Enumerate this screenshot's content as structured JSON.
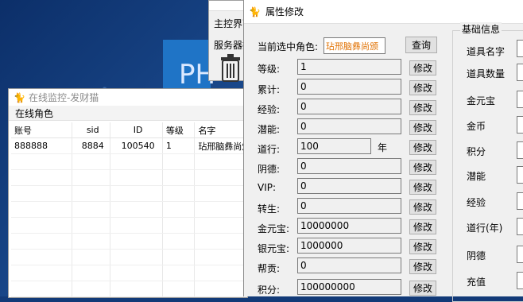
{
  "main_window": {
    "row1": "主控界面",
    "row2": "服务器控"
  },
  "blue_tile": "PH",
  "monitor": {
    "title": "在线监控-发财猫",
    "menu": "在线角色",
    "columns": [
      "账号",
      "sid",
      "ID",
      "等级",
      "名字"
    ],
    "rows": [
      [
        "888888",
        "8884",
        "100540",
        "1",
        "玷邢脑彝尚颁"
      ]
    ]
  },
  "props": {
    "title": "属性修改",
    "selected_label": "当前选中角色:",
    "selected_value": "玷邢脑彝尚颁",
    "query_button": "查询",
    "modify_label": "修改",
    "year_unit": "年",
    "fields": [
      {
        "label": "等级:",
        "value": "1"
      },
      {
        "label": "累计:",
        "value": "0"
      },
      {
        "label": "经验:",
        "value": "0"
      },
      {
        "label": "潜能:",
        "value": "0"
      },
      {
        "label": "道行:",
        "value": "100"
      },
      {
        "label": "阴德:",
        "value": "0"
      },
      {
        "label": "VIP:",
        "value": "0"
      },
      {
        "label": "转生:",
        "value": "0"
      },
      {
        "label": "金元宝:",
        "value": "10000000"
      },
      {
        "label": "银元宝:",
        "value": "1000000"
      },
      {
        "label": "帮贡:",
        "value": "0"
      },
      {
        "label": "积分:",
        "value": "100000000"
      }
    ],
    "basic_info": {
      "title": "基础信息",
      "labels": [
        "道具名字",
        "道具数量",
        "金元宝",
        "金币",
        "积分",
        "潜能",
        "经验",
        "道行(年)",
        "阴德",
        "充值"
      ]
    }
  }
}
